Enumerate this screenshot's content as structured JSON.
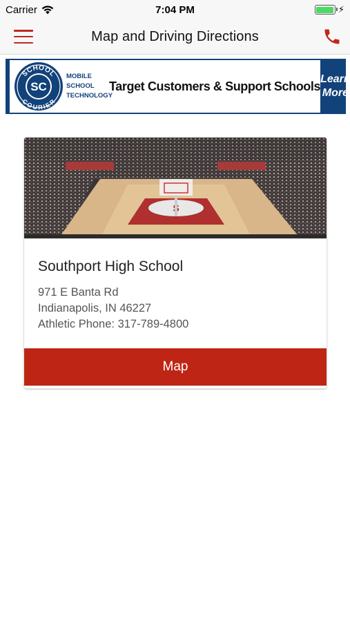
{
  "status_bar": {
    "carrier": "Carrier",
    "time": "7:04 PM",
    "battery_level": 1.0
  },
  "nav": {
    "title": "Map and Driving Directions",
    "menu_icon": "hamburger-menu-icon",
    "phone_icon": "phone-icon"
  },
  "banner": {
    "logo_top": "SCHOOL",
    "logo_center": "SC",
    "logo_bottom": "COURIER",
    "subtitle_lines": [
      "MOBILE",
      "SCHOOL",
      "TECHNOLOGY"
    ],
    "tagline": "Target Customers & Support Schools",
    "cta_lines": [
      "Learn",
      "More"
    ]
  },
  "card": {
    "school_name": "Southport High School",
    "address_line1": "971 E Banta Rd",
    "address_line2": "Indianapolis, IN 46227",
    "phone_line": "Athletic Phone: 317-789-4800",
    "map_button": "Map"
  },
  "colors": {
    "accent_red": "#bf2514",
    "banner_blue": "#12427a"
  }
}
